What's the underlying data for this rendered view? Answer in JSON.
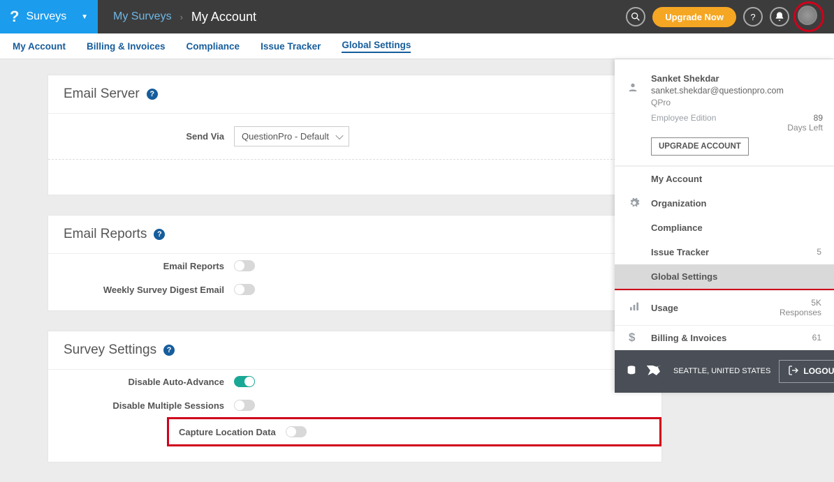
{
  "brand": {
    "app_name": "Surveys"
  },
  "crumbs": {
    "parent": "My Surveys",
    "current": "My Account"
  },
  "top": {
    "upgrade": "Upgrade Now"
  },
  "subnav": {
    "my_account": "My Account",
    "billing": "Billing & Invoices",
    "compliance": "Compliance",
    "issue_tracker": "Issue Tracker",
    "global_settings": "Global Settings"
  },
  "sections": {
    "email_server": {
      "title": "Email Server",
      "send_via_label": "Send Via",
      "send_via_value": "QuestionPro - Default"
    },
    "email_reports": {
      "title": "Email Reports",
      "email_reports_label": "Email Reports",
      "weekly_digest_label": "Weekly Survey Digest Email"
    },
    "survey_settings": {
      "title": "Survey Settings",
      "disable_auto_advance": "Disable Auto-Advance",
      "disable_multiple_sessions": "Disable Multiple Sessions",
      "capture_location": "Capture Location Data"
    }
  },
  "panel": {
    "user": {
      "name": "Sanket Shekdar",
      "email": "sanket.shekdar@questionpro.com",
      "org": "QPro",
      "edition": "Employee Edition",
      "days_left_num": "89",
      "days_left_label": "Days Left",
      "upgrade_btn": "UPGRADE ACCOUNT"
    },
    "items": {
      "my_account": "My Account",
      "organization": "Organization",
      "compliance": "Compliance",
      "issue_tracker": "Issue Tracker",
      "issue_tracker_count": "5",
      "global_settings": "Global Settings",
      "usage": "Usage",
      "usage_count": "5K",
      "usage_unit": "Responses",
      "billing": "Billing & Invoices",
      "billing_count": "61"
    },
    "footer": {
      "location": "SEATTLE, UNITED STATES",
      "logout": "LOGOUT"
    }
  }
}
